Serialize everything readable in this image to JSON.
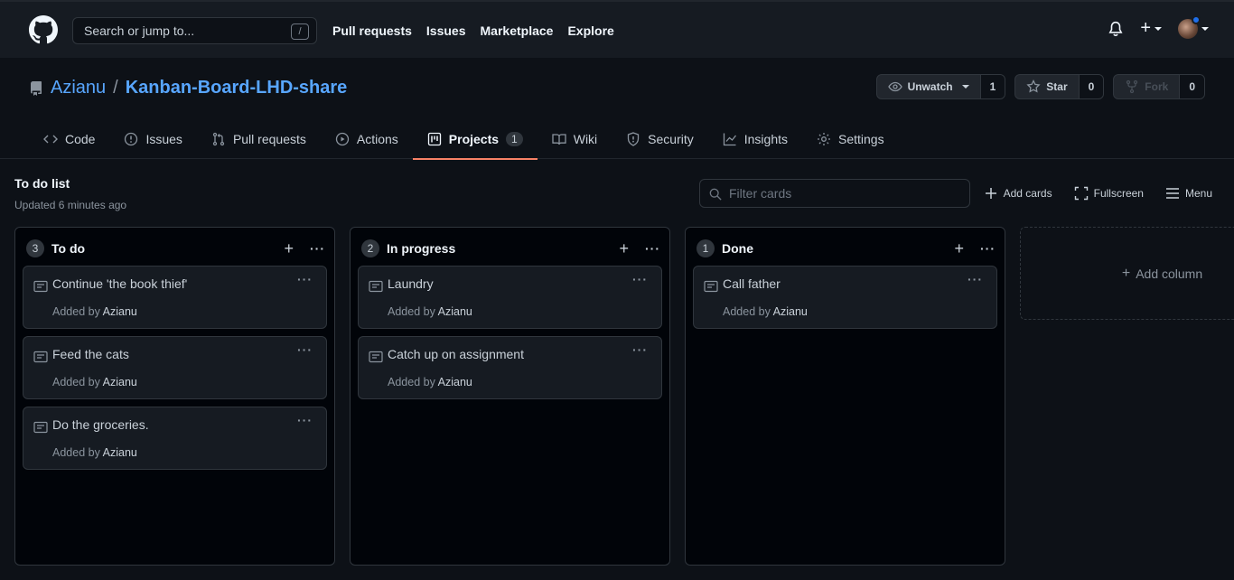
{
  "header": {
    "search_placeholder": "Search or jump to...",
    "search_shortcut": "/",
    "nav": [
      "Pull requests",
      "Issues",
      "Marketplace",
      "Explore"
    ],
    "plus": "+"
  },
  "repo": {
    "owner": "Azianu",
    "separator": "/",
    "name": "Kanban-Board-LHD-share",
    "unwatch_label": "Unwatch",
    "watch_count": "1",
    "star_label": "Star",
    "star_count": "0",
    "fork_label": "Fork",
    "fork_count": "0"
  },
  "tabs": [
    {
      "label": "Code",
      "icon": "code-icon"
    },
    {
      "label": "Issues",
      "icon": "issue-icon"
    },
    {
      "label": "Pull requests",
      "icon": "pull-request-icon"
    },
    {
      "label": "Actions",
      "icon": "play-icon"
    },
    {
      "label": "Projects",
      "icon": "project-icon",
      "counter": "1",
      "active": true
    },
    {
      "label": "Wiki",
      "icon": "book-icon"
    },
    {
      "label": "Security",
      "icon": "shield-icon"
    },
    {
      "label": "Insights",
      "icon": "graph-icon"
    },
    {
      "label": "Settings",
      "icon": "gear-icon"
    }
  ],
  "project": {
    "title": "To do list",
    "updated": "Updated 6 minutes ago",
    "filter_placeholder": "Filter cards",
    "add_cards": "Add cards",
    "fullscreen": "Fullscreen",
    "menu": "Menu",
    "add_column": "Add column"
  },
  "columns": [
    {
      "count": "3",
      "name": "To do",
      "cards": [
        {
          "title": "Continue 'the book thief'",
          "added_by": "Added by",
          "author": "Azianu"
        },
        {
          "title": "Feed the cats",
          "added_by": "Added by",
          "author": "Azianu"
        },
        {
          "title": "Do the groceries.",
          "added_by": "Added by",
          "author": "Azianu"
        }
      ]
    },
    {
      "count": "2",
      "name": "In progress",
      "cards": [
        {
          "title": "Laundry",
          "added_by": "Added by",
          "author": "Azianu"
        },
        {
          "title": "Catch up on assignment",
          "added_by": "Added by",
          "author": "Azianu"
        }
      ]
    },
    {
      "count": "1",
      "name": "Done",
      "cards": [
        {
          "title": "Call father",
          "added_by": "Added by",
          "author": "Azianu"
        }
      ]
    }
  ],
  "colors": {
    "accent_link": "#58a6ff",
    "active_tab_underline": "#f78166",
    "background": "#0d1117"
  }
}
